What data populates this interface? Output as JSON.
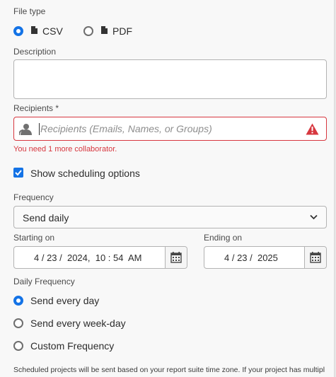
{
  "file_type": {
    "label": "File type",
    "options": [
      {
        "label": "CSV",
        "selected": true,
        "icon": "file-icon"
      },
      {
        "label": "PDF",
        "selected": false,
        "icon": "file-icon"
      }
    ]
  },
  "description": {
    "label": "Description",
    "value": ""
  },
  "recipients": {
    "label": "Recipients",
    "required_marker": "*",
    "placeholder": "Recipients (Emails, Names, or Groups)",
    "error": "You need 1 more collaborator."
  },
  "scheduling": {
    "label": "Show scheduling options",
    "checked": true
  },
  "frequency": {
    "label": "Frequency",
    "value": "Send daily"
  },
  "starting_on": {
    "label": "Starting on",
    "value": "4 / 23 /  2024,  10 : 54  AM"
  },
  "ending_on": {
    "label": "Ending on",
    "value": "4 / 23 /  2025"
  },
  "daily_frequency": {
    "label": "Daily Frequency",
    "options": [
      {
        "label": "Send every day",
        "selected": true
      },
      {
        "label": "Send every week-day",
        "selected": false
      },
      {
        "label": "Custom Frequency",
        "selected": false
      }
    ]
  },
  "footnote": "Scheduled projects will be sent based on your report suite time zone. If your project has multiple",
  "colors": {
    "accent": "#1473e6",
    "error": "#d7373f"
  }
}
